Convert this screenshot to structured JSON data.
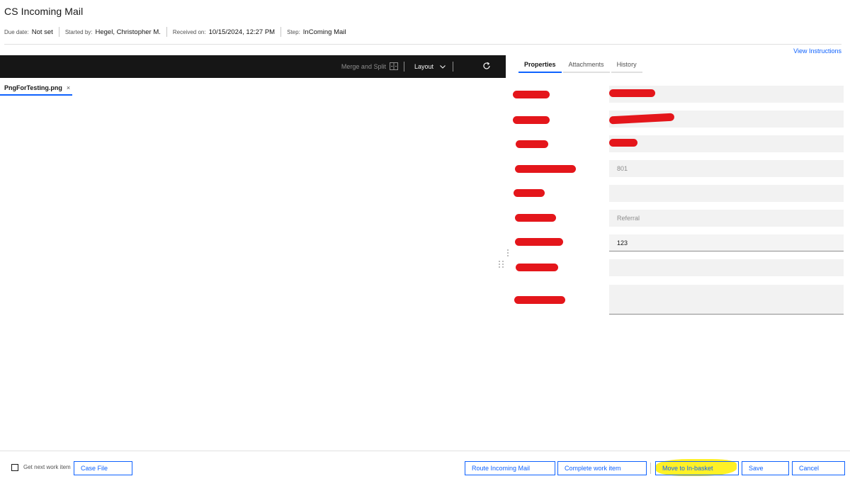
{
  "header": {
    "title": "CS Incoming Mail",
    "meta": [
      {
        "label": "Due date:",
        "value": "Not set"
      },
      {
        "label": "Started by:",
        "value": "Hegel, Christopher M."
      },
      {
        "label": "Received on:",
        "value": "10/15/2024, 12:27 PM"
      },
      {
        "label": "Step:",
        "value": "InComing Mail"
      }
    ],
    "view_instructions": "View Instructions"
  },
  "viewer": {
    "merge_split": "Merge and Split",
    "layout": "Layout",
    "document_tab": "PngForTesting.png",
    "close_glyph": "×"
  },
  "properties_panel": {
    "tabs": [
      "Properties",
      "Attachments",
      "History"
    ],
    "active_tab": "Properties",
    "fields": [
      {
        "value": "",
        "label_redacted": true,
        "value_redacted": true
      },
      {
        "value": "",
        "label_redacted": true,
        "value_redacted": true
      },
      {
        "value": "",
        "label_redacted": true,
        "value_redacted": true
      },
      {
        "value": "801",
        "label_redacted": true
      },
      {
        "value": "",
        "label_redacted": true
      },
      {
        "value": "Referral",
        "label_redacted": true
      },
      {
        "value": "123",
        "label_redacted": true
      },
      {
        "value": "",
        "label_redacted": true
      },
      {
        "value": "",
        "label_redacted": true
      }
    ]
  },
  "footer": {
    "get_next": "Get next work item",
    "case_file": "Case File",
    "route": "Route Incoming Mail",
    "complete": "Complete work item",
    "move": "Move to In-basket",
    "save": "Save",
    "cancel": "Cancel"
  },
  "colors": {
    "accent": "#0f62fe",
    "toolbar_bg": "#161616",
    "highlight": "#ffee00",
    "redaction": "#e4161b"
  }
}
